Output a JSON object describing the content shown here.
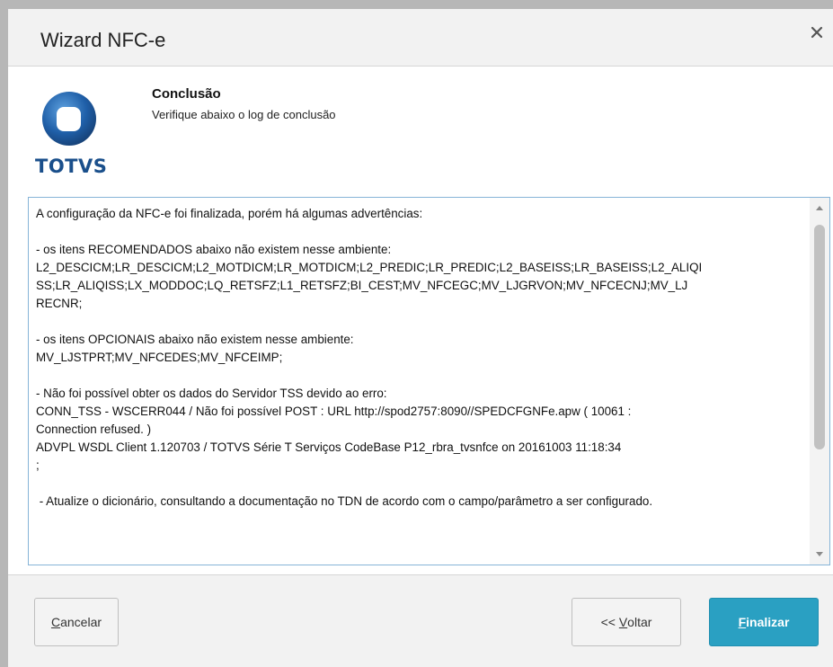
{
  "dialog": {
    "title": "Wizard NFC-e"
  },
  "header": {
    "logo_text": "TOTVS",
    "step_title": "Conclusão",
    "step_subtitle": "Verifique abaixo o log de conclusão"
  },
  "log": {
    "lines": [
      "A configuração da NFC-e foi finalizada, porém há algumas advertências:",
      "",
      "- os itens RECOMENDADOS abaixo não existem nesse ambiente:",
      "L2_DESCICM;LR_DESCICM;L2_MOTDICM;LR_MOTDICM;L2_PREDIC;LR_PREDIC;L2_BASEISS;LR_BASEISS;L2_ALIQI",
      "SS;LR_ALIQISS;LX_MODDOC;LQ_RETSFZ;L1_RETSFZ;BI_CEST;MV_NFCEGC;MV_LJGRVON;MV_NFCECNJ;MV_LJ",
      "RECNR;",
      "",
      "- os itens OPCIONAIS abaixo não existem nesse ambiente:",
      "MV_LJSTPRT;MV_NFCEDES;MV_NFCEIMP;",
      "",
      "- Não foi possível obter os dados do Servidor TSS devido ao erro:",
      "CONN_TSS - WSCERR044 / Não foi possível POST : URL http://spod2757:8090//SPEDCFGNFe.apw ( 10061 :",
      "Connection refused. )",
      "ADVPL WSDL Client 1.120703 / TOTVS Série T Serviços CodeBase P12_rbra_tvsnfce on 20161003 11:18:34",
      ";",
      "",
      " - Atualize o dicionário, consultando a documentação no TDN de acordo com o campo/parâmetro a ser configurado."
    ]
  },
  "footer": {
    "cancel": {
      "first": "C",
      "rest": "ancelar"
    },
    "back": {
      "prefix": "<< ",
      "underlined": "V",
      "rest": "oltar"
    },
    "finish": {
      "first": "F",
      "rest": "inalizar"
    }
  },
  "colors": {
    "finish_button": "#2aa0c2",
    "logo_blue": "#1a4f8b",
    "log_border": "#86b4d8"
  },
  "icons": [
    "close-icon",
    "totvs-logo",
    "scroll-up-arrow-icon",
    "scroll-down-arrow-icon"
  ]
}
